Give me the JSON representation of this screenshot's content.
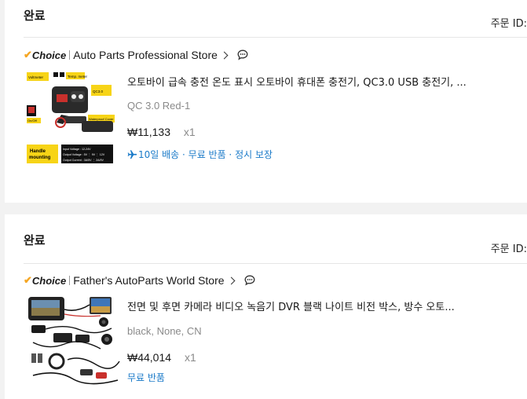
{
  "orders": [
    {
      "status": "완료",
      "order_id_label": "주문 ID:",
      "store": {
        "choice_label": "Choice",
        "name": "Auto Parts Professional Store"
      },
      "product": {
        "title": "오토바이 급속 충전 온도 표시 오토바이 휴대폰 충전기, QC3.0 USB 충전기, ...",
        "variant": "QC 3.0 Red-1",
        "price": "₩11,133",
        "quantity": "x1",
        "badges": "10일 배송 · 무료 반품 · 정시 보장",
        "image_labels": [
          "Voltmeter",
          "Temp. meter",
          "QC3.0",
          "On/Off",
          "Waterproof Cover",
          "Handle mounting",
          "Input Voltage : 12-24V",
          "Output Voltage : 5V ⋮ 9V ⋮ 12V",
          "Output Current : 3A/5V ⋮ 2A/9V"
        ]
      }
    },
    {
      "status": "완료",
      "order_id_label": "주문 ID:",
      "store": {
        "choice_label": "Choice",
        "name": "Father's AutoParts World Store"
      },
      "product": {
        "title": "전면 및 후면 카메라 비디오 녹음기 DVR 블랙 나이트 비전 박스, 방수 오토...",
        "variant": "black, None, CN",
        "price": "₩44,014",
        "quantity": "x1",
        "badges": "무료 반품"
      }
    }
  ],
  "colors": {
    "accent_blue": "#1a7ac8",
    "choice_orange": "#f5a623",
    "product_yellow": "#f7d417"
  },
  "icons": [
    "chat-icon",
    "chevron-right-icon",
    "plane-icon",
    "checkmark-icon"
  ]
}
